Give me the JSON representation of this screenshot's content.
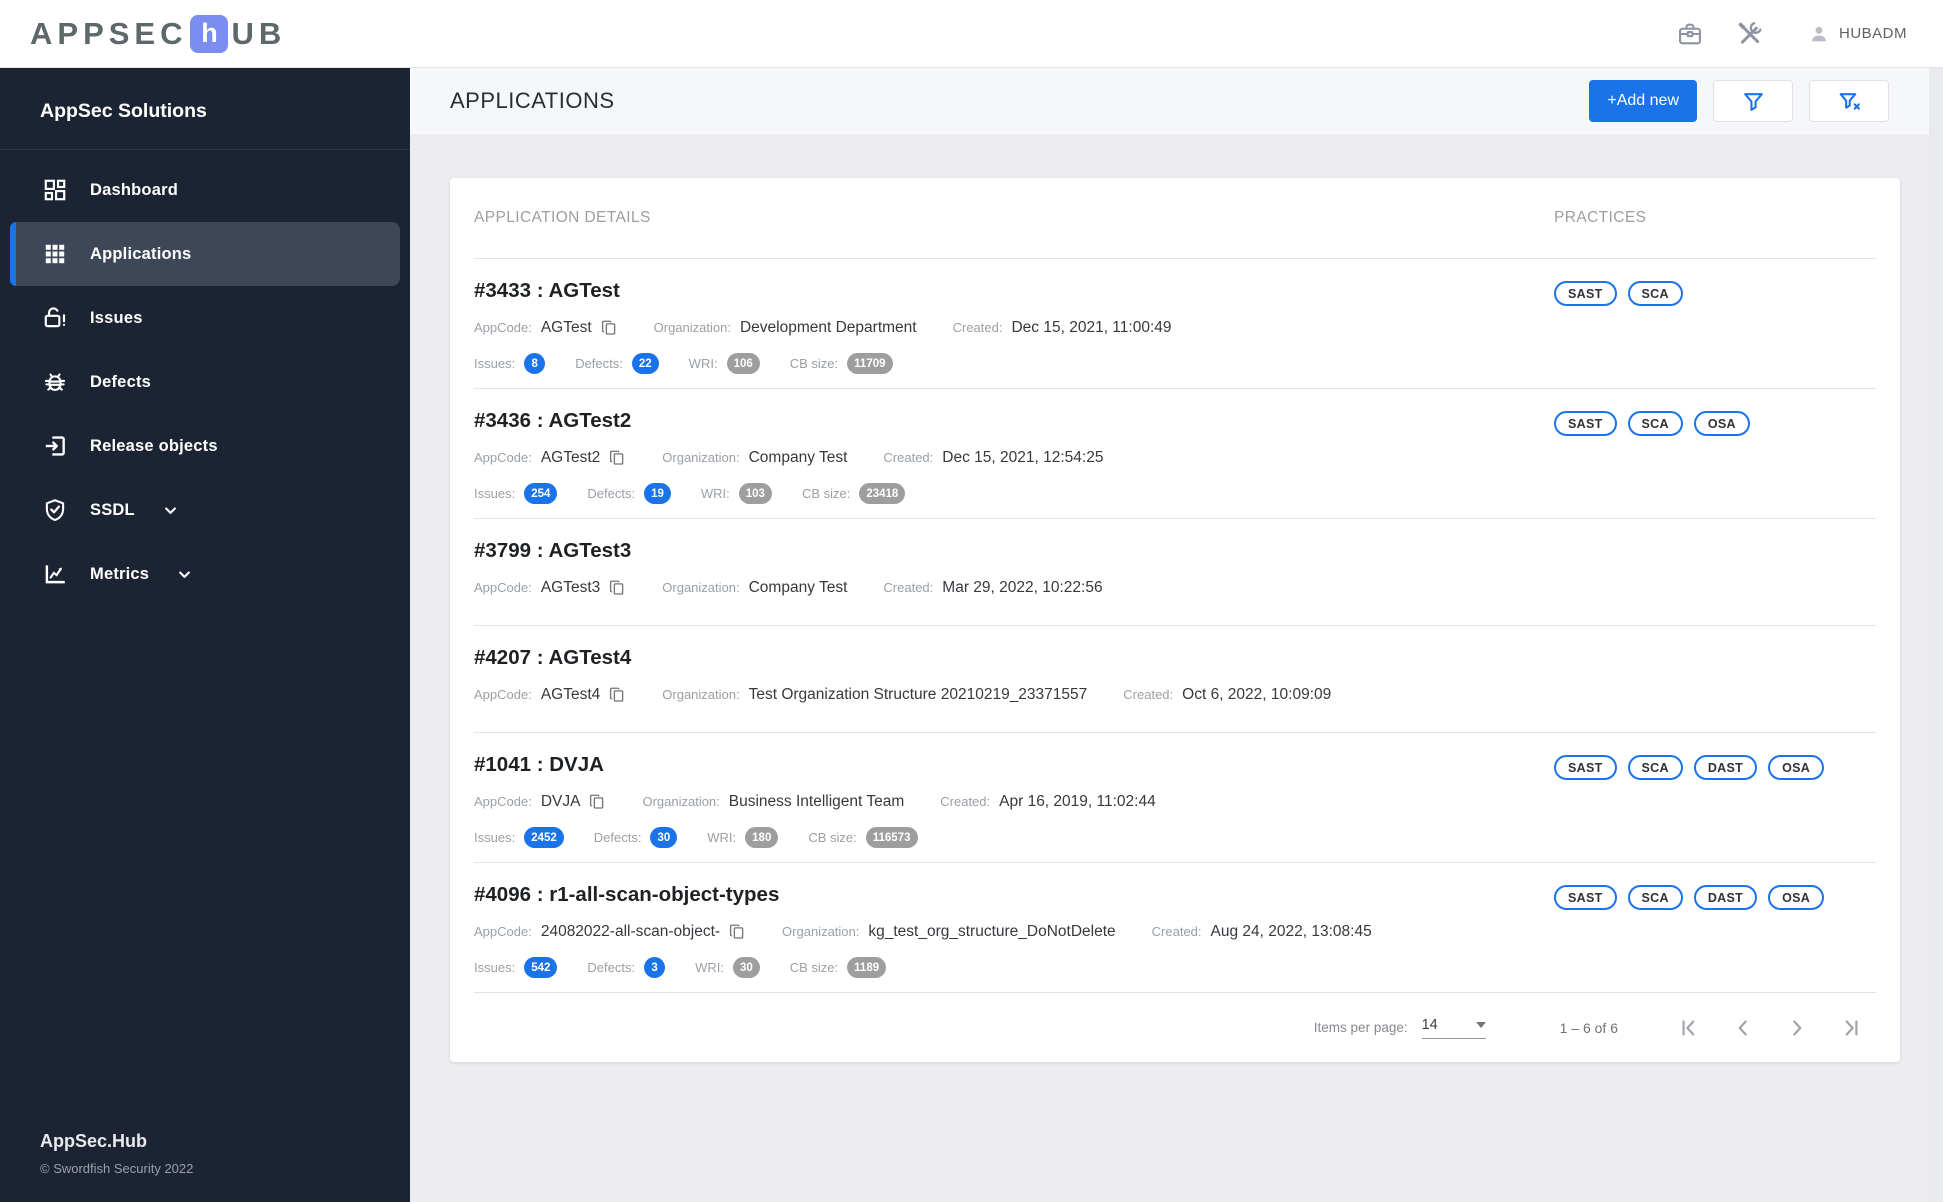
{
  "topbar": {
    "logo": {
      "text_left": "APPSEC",
      "text_mid": "h",
      "text_right": "UB"
    },
    "user": "HUBADM"
  },
  "sidebar": {
    "title": "AppSec Solutions",
    "items": [
      {
        "label": "Dashboard"
      },
      {
        "label": "Applications"
      },
      {
        "label": "Issues"
      },
      {
        "label": "Defects"
      },
      {
        "label": "Release objects"
      },
      {
        "label": "SSDL"
      },
      {
        "label": "Metrics"
      }
    ],
    "footer": {
      "product": "AppSec.Hub",
      "copyright": "© Swordfish Security 2022"
    }
  },
  "header": {
    "title": "APPLICATIONS",
    "add_button": "+Add new"
  },
  "table": {
    "columns": {
      "details": "APPLICATION DETAILS",
      "practices": "PRACTICES"
    },
    "labels": {
      "app_code": "AppCode:",
      "organization": "Organization:",
      "created": "Created:",
      "issues": "Issues:",
      "defects": "Defects:",
      "wri": "WRI:",
      "cb_size": "CB size:"
    },
    "rows": [
      {
        "title": "#3433 : AGTest",
        "app_code": "AGTest",
        "organization": "Development Department",
        "created": "Dec 15, 2021, 11:00:49",
        "stats": {
          "issues": "8",
          "defects": "22",
          "wri": "106",
          "cb_size": "11709"
        },
        "practices": [
          "SAST",
          "SCA"
        ]
      },
      {
        "title": "#3436 : AGTest2",
        "app_code": "AGTest2",
        "organization": "Company Test",
        "created": "Dec 15, 2021, 12:54:25",
        "stats": {
          "issues": "254",
          "defects": "19",
          "wri": "103",
          "cb_size": "23418"
        },
        "practices": [
          "SAST",
          "SCA",
          "OSA"
        ]
      },
      {
        "title": "#3799 : AGTest3",
        "app_code": "AGTest3",
        "organization": "Company Test",
        "created": "Mar 29, 2022, 10:22:56",
        "stats": null,
        "practices": []
      },
      {
        "title": "#4207 : AGTest4",
        "app_code": "AGTest4",
        "organization": "Test Organization Structure 20210219_23371557",
        "created": "Oct 6, 2022, 10:09:09",
        "stats": null,
        "practices": []
      },
      {
        "title": "#1041 : DVJA",
        "app_code": "DVJA",
        "organization": "Business Intelligent Team",
        "created": "Apr 16, 2019, 11:02:44",
        "stats": {
          "issues": "2452",
          "defects": "30",
          "wri": "180",
          "cb_size": "116573"
        },
        "practices": [
          "SAST",
          "SCA",
          "DAST",
          "OSA"
        ]
      },
      {
        "title": "#4096 : r1-all-scan-object-types",
        "app_code": "24082022-all-scan-object-",
        "organization": "kg_test_org_structure_DoNotDelete",
        "created": "Aug 24, 2022, 13:08:45",
        "stats": {
          "issues": "542",
          "defects": "3",
          "wri": "30",
          "cb_size": "1189"
        },
        "practices": [
          "SAST",
          "SCA",
          "DAST",
          "OSA"
        ]
      }
    ]
  },
  "pagination": {
    "items_per_page_label": "Items per page:",
    "items_per_page": "14",
    "range": "1 – 6 of 6"
  },
  "colors": {
    "accent": "#1a73e8",
    "pill_gray": "#9e9e9e",
    "sidebar_bg": "#1c2433"
  }
}
